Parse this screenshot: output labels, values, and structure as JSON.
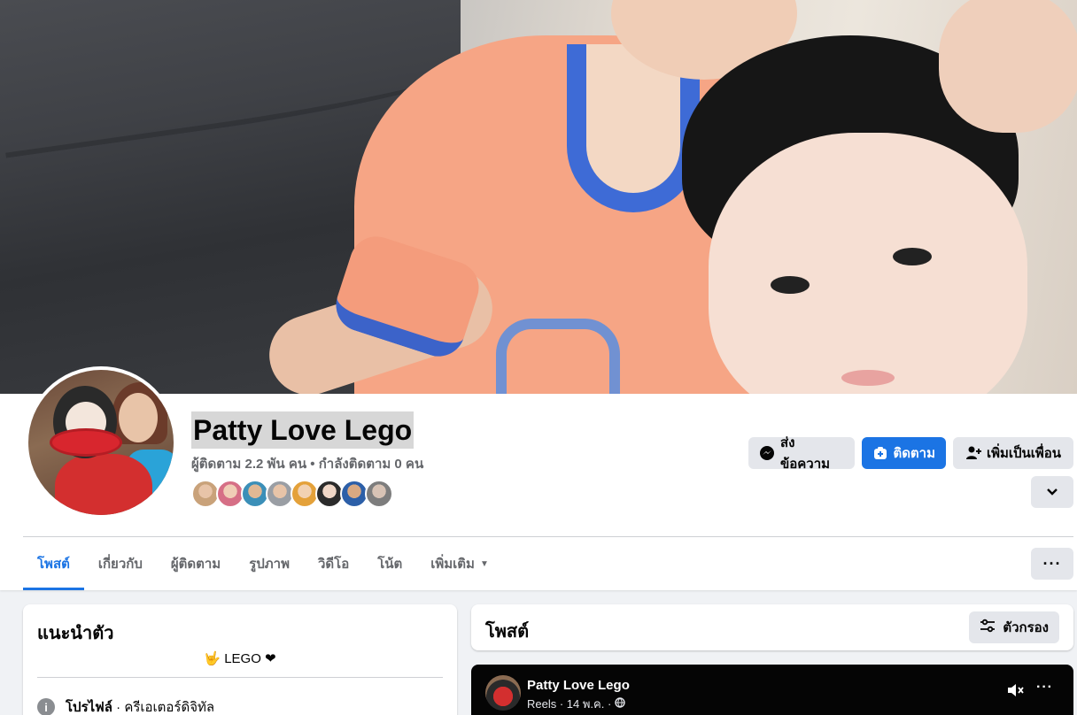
{
  "profile": {
    "name": "Patty Love Lego",
    "followers_text": "ผู้ติดตาม 2.2 พัน คน • กำลังติดตาม 0 คน"
  },
  "actions": {
    "message_label": "ส่งข้อความ",
    "follow_label": "ติดตาม",
    "add_friend_label": "เพิ่มเป็นเพื่อน"
  },
  "tabs": [
    {
      "label": "โพสต์"
    },
    {
      "label": "เกี่ยวกับ"
    },
    {
      "label": "ผู้ติดตาม"
    },
    {
      "label": "รูปภาพ"
    },
    {
      "label": "วิดีโอ"
    },
    {
      "label": "โน้ต"
    },
    {
      "label": "เพิ่มเติม"
    }
  ],
  "intro": {
    "title": "แนะนำตัว",
    "bio": "🤟 LEGO ❤",
    "profile_type_label": "โปรไฟล์",
    "profile_type_value": " · ครีเอเตอร์ดิจิทัล"
  },
  "posts": {
    "title": "โพสต์",
    "filter_label": "ตัวกรอง"
  },
  "reel_post": {
    "author": "Patty Love Lego",
    "meta": "Reels · 14 พ.ค. ·"
  },
  "colors": {
    "accent": "#1b74e4",
    "page_bg": "#f0f2f5",
    "button_grey": "#e4e6eb"
  },
  "icons": {
    "message": "messenger-icon",
    "follow": "follow-icon",
    "add_friend": "add-friend-icon",
    "dropdown": "chevron-down-icon",
    "more": "more-icon",
    "filter": "filter-icon",
    "info": "info-icon",
    "mute": "mute-icon",
    "globe": "globe-icon"
  }
}
